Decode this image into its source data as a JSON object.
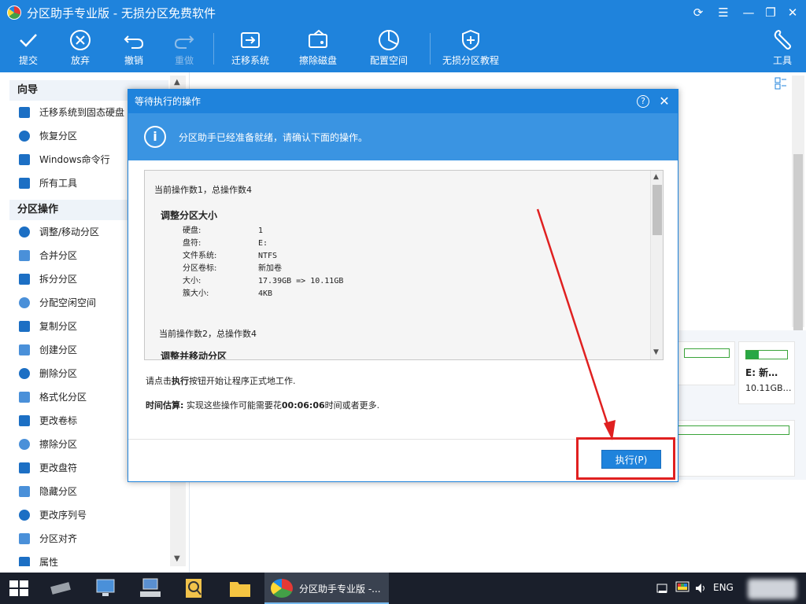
{
  "window": {
    "title": "分区助手专业版 - 无损分区免费软件"
  },
  "toolbar": {
    "commit": "提交",
    "discard": "放弃",
    "undo": "撤销",
    "redo": "重做",
    "migrate_os": "迁移系统",
    "wipe_disk": "擦除磁盘",
    "alloc_space": "配置空间",
    "tutorial": "无损分区教程",
    "tools": "工具"
  },
  "sidebar": {
    "wizard_title": "向导",
    "wizard_items": [
      "迁移系统到固态硬盘",
      "恢复分区",
      "Windows命令行",
      "所有工具"
    ],
    "ops_title": "分区操作",
    "ops_items": [
      "调整/移动分区",
      "合并分区",
      "拆分分区",
      "分配空闲空间",
      "复制分区",
      "创建分区",
      "删除分区",
      "格式化分区",
      "更改卷标",
      "擦除分区",
      "更改盘符",
      "隐藏分区",
      "更改序列号",
      "分区对齐",
      "属性"
    ]
  },
  "disk_cards": {
    "e_label": "E: 新…",
    "e_size": "10.11GB…"
  },
  "dialog": {
    "title": "等待执行的操作",
    "help": "?",
    "info_message": "分区助手已经准备就绪，请确认下面的操作。",
    "ops": {
      "op1_count": "当前操作数1，总操作数4",
      "op1_title": "调整分区大小",
      "rows": [
        {
          "k": "硬盘:",
          "v": "1"
        },
        {
          "k": "盘符:",
          "v": "E:"
        },
        {
          "k": "文件系统:",
          "v": "NTFS"
        },
        {
          "k": "分区卷标:",
          "v": "新加卷"
        },
        {
          "k": "大小:",
          "v": "17.39GB => 10.11GB"
        },
        {
          "k": "簇大小:",
          "v": "4KB"
        }
      ],
      "op2_count": "当前操作数2，总操作数4",
      "op2_title": "调整并移动分区"
    },
    "instruction_pre": "请点击",
    "instruction_bold": "执行",
    "instruction_post": "按钮开始让程序正式地工作.",
    "estimate_label": "时间估算:",
    "estimate_pre": " 实现这些操作可能需要花",
    "estimate_time": "00:06:06",
    "estimate_post": "时间或者更多.",
    "execute_button": "执行(P)"
  },
  "taskbar": {
    "active_task": "分区助手专业版 -...",
    "language": "ENG"
  },
  "colors": {
    "accent": "#1f83dc",
    "highlight": "#e02020"
  }
}
